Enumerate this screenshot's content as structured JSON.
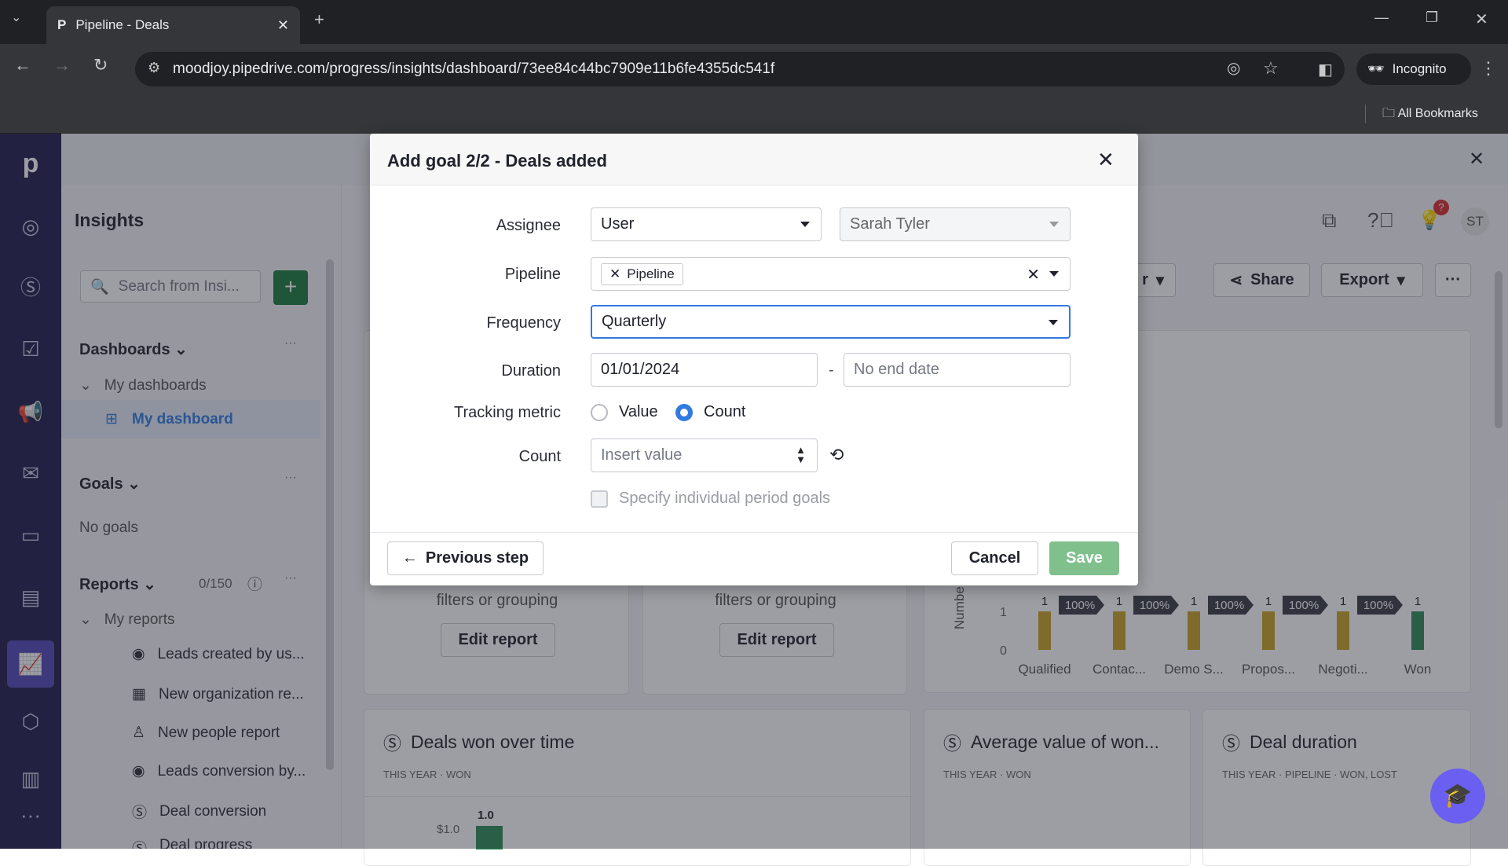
{
  "browser": {
    "tab_title": "Pipeline - Deals",
    "url": "moodjoy.pipedrive.com/progress/insights/dashboard/73ee84c44bc7909e11b6fe4355dc541f",
    "incognito": "Incognito",
    "bookmarks": "All Bookmarks"
  },
  "sidebar": {
    "title": "Insights",
    "search_placeholder": "Search from Insi...",
    "dashboards": "Dashboards",
    "my_dashboards": "My dashboards",
    "my_dashboard": "My dashboard",
    "goals": "Goals",
    "no_goals": "No goals",
    "reports": "Reports",
    "reports_count": "0/150",
    "my_reports": "My reports",
    "report_items": [
      {
        "label": "Leads created by us...",
        "icon": "target-icon"
      },
      {
        "label": "New organization re...",
        "icon": "building-icon"
      },
      {
        "label": "New people report",
        "icon": "person-icon"
      },
      {
        "label": "Leads conversion by...",
        "icon": "target-icon"
      },
      {
        "label": "Deal conversion",
        "icon": "dollar-icon"
      },
      {
        "label": "Deal progress",
        "icon": "dollar-icon"
      }
    ]
  },
  "header": {
    "avatar": "ST",
    "notification_badge": "?"
  },
  "toolbar": {
    "partial": "r",
    "share": "Share",
    "export": "Export",
    "more": "···"
  },
  "cards": {
    "empty_text": "filters or grouping",
    "edit_report": "Edit report",
    "bottom": [
      {
        "title": "Deals won over time",
        "subtitle": [
          "THIS YEAR",
          "WON"
        ]
      },
      {
        "title": "Average value of won...",
        "subtitle": [
          "THIS YEAR",
          "WON"
        ]
      },
      {
        "title": "Deal duration",
        "subtitle": [
          "THIS YEAR",
          "PIPELINE",
          "WON, LOST"
        ]
      }
    ],
    "mini_chart": {
      "tick": "$1.0",
      "value_label": "1.0"
    }
  },
  "chart_data": {
    "type": "bar",
    "ylabel": "Numbe",
    "categories": [
      "Qualified",
      "Contac...",
      "Demo S...",
      "Propos...",
      "Negoti...",
      "Won"
    ],
    "values": [
      1,
      1,
      1,
      1,
      1,
      1
    ],
    "conversions": [
      "100%",
      "100%",
      "100%",
      "100%",
      "100%"
    ],
    "yticks": [
      "0",
      "1"
    ],
    "ylim": [
      0,
      1
    ],
    "colors": {
      "stage": "#c9a227",
      "won": "#2e8b57"
    }
  },
  "modal": {
    "title": "Add goal 2/2 - Deals added",
    "assignee_label": "Assignee",
    "assignee_type": "User",
    "assignee_user": "Sarah Tyler",
    "pipeline_label": "Pipeline",
    "pipeline_tag": "Pipeline",
    "frequency_label": "Frequency",
    "frequency": "Quarterly",
    "duration_label": "Duration",
    "start_date": "01/01/2024",
    "end_placeholder": "No end date",
    "dash": "-",
    "tracking_label": "Tracking metric",
    "metric_value": "Value",
    "metric_count": "Count",
    "selected_metric": "Count",
    "count_label": "Count",
    "count_placeholder": "Insert value",
    "specify_label": "Specify individual period goals",
    "prev": "Previous step",
    "cancel": "Cancel",
    "save": "Save"
  },
  "colors": {
    "accent": "#317ae2",
    "save": "#80c08d",
    "rail": "#1f1d4d",
    "add": "#1b7a3c"
  }
}
